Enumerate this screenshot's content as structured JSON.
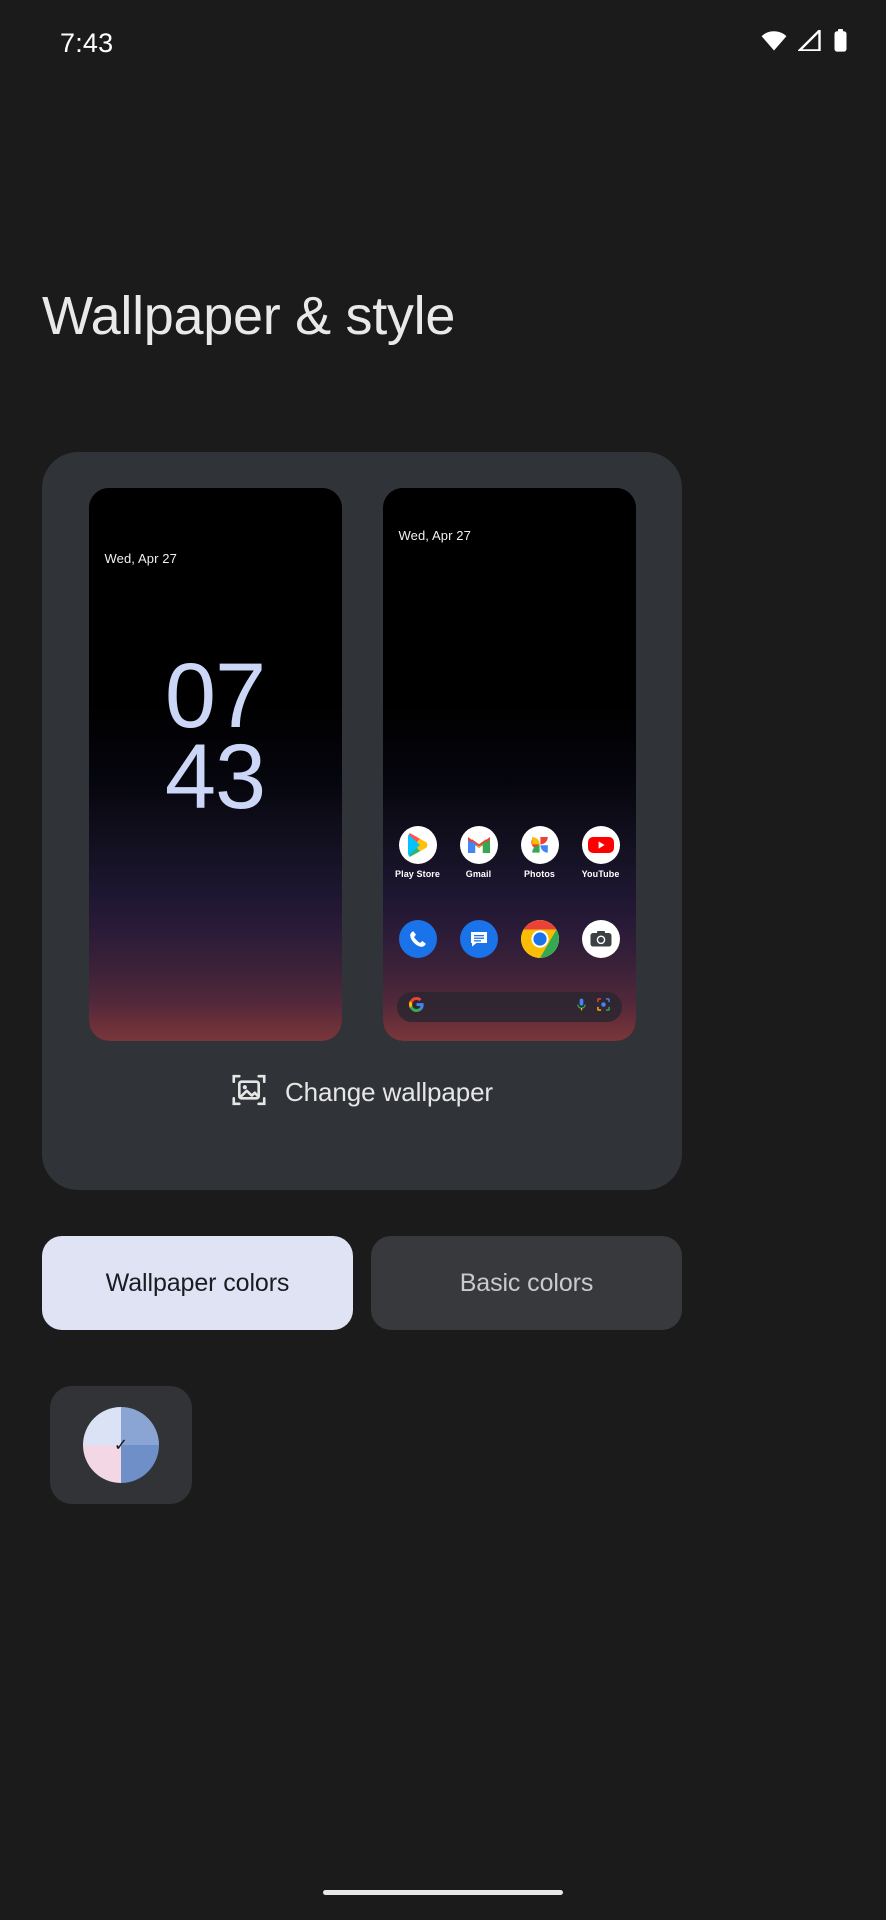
{
  "status_bar": {
    "time": "7:43",
    "icons": [
      "wifi-icon",
      "cell-signal-icon",
      "battery-icon"
    ]
  },
  "header": {
    "title": "Wallpaper & style"
  },
  "preview": {
    "lock_screen": {
      "label": "lock-screen-preview",
      "date": "Wed, Apr 27",
      "clock_hours": "07",
      "clock_minutes": "43",
      "clock_color": "#ccd6f6"
    },
    "home_screen": {
      "label": "home-screen-preview",
      "date": "Wed, Apr 27",
      "apps": [
        {
          "name": "Play Store",
          "icon": "play-store-icon"
        },
        {
          "name": "Gmail",
          "icon": "gmail-icon"
        },
        {
          "name": "Photos",
          "icon": "google-photos-icon"
        },
        {
          "name": "YouTube",
          "icon": "youtube-icon"
        }
      ],
      "dock": [
        {
          "name": "Phone",
          "icon": "phone-icon"
        },
        {
          "name": "Messages",
          "icon": "messages-icon"
        },
        {
          "name": "Chrome",
          "icon": "chrome-icon"
        },
        {
          "name": "Camera",
          "icon": "camera-icon"
        }
      ],
      "search_bar": {
        "left_icon": "google-g-icon",
        "mic_icon": "microphone-icon",
        "lens_icon": "google-lens-icon"
      }
    },
    "change_wallpaper": {
      "label": "Change wallpaper",
      "icon": "image-picker-icon"
    }
  },
  "color_tabs": [
    {
      "label": "Wallpaper colors",
      "selected": true
    },
    {
      "label": "Basic colors",
      "selected": false
    }
  ],
  "color_swatches": [
    {
      "name": "wallpaper-color-option-1",
      "selected": true,
      "quadrants": [
        "#dce2f5",
        "#8aa4d4",
        "#f3d7e4",
        "#6f8fc9"
      ],
      "check": "✓"
    }
  ],
  "nav_bar": {
    "gesture_pill": "home-gesture-pill"
  },
  "theme": {
    "background": "#1b1b1b",
    "card_background": "#303337",
    "tab_selected_bg": "#dfe3f3",
    "tab_unselected_bg": "#37393d",
    "text_primary": "#e9e9e9"
  }
}
